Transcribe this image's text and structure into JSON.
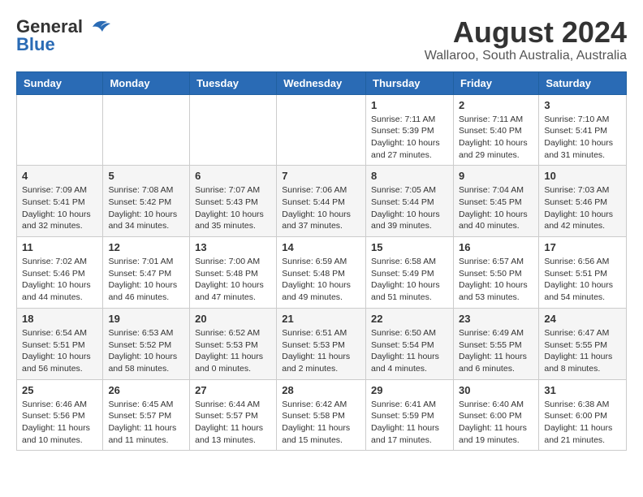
{
  "header": {
    "logo_general": "General",
    "logo_blue": "Blue",
    "month": "August 2024",
    "location": "Wallaroo, South Australia, Australia"
  },
  "weekdays": [
    "Sunday",
    "Monday",
    "Tuesday",
    "Wednesday",
    "Thursday",
    "Friday",
    "Saturday"
  ],
  "weeks": [
    [
      {
        "day": "",
        "info": ""
      },
      {
        "day": "",
        "info": ""
      },
      {
        "day": "",
        "info": ""
      },
      {
        "day": "",
        "info": ""
      },
      {
        "day": "1",
        "info": "Sunrise: 7:11 AM\nSunset: 5:39 PM\nDaylight: 10 hours\nand 27 minutes."
      },
      {
        "day": "2",
        "info": "Sunrise: 7:11 AM\nSunset: 5:40 PM\nDaylight: 10 hours\nand 29 minutes."
      },
      {
        "day": "3",
        "info": "Sunrise: 7:10 AM\nSunset: 5:41 PM\nDaylight: 10 hours\nand 31 minutes."
      }
    ],
    [
      {
        "day": "4",
        "info": "Sunrise: 7:09 AM\nSunset: 5:41 PM\nDaylight: 10 hours\nand 32 minutes."
      },
      {
        "day": "5",
        "info": "Sunrise: 7:08 AM\nSunset: 5:42 PM\nDaylight: 10 hours\nand 34 minutes."
      },
      {
        "day": "6",
        "info": "Sunrise: 7:07 AM\nSunset: 5:43 PM\nDaylight: 10 hours\nand 35 minutes."
      },
      {
        "day": "7",
        "info": "Sunrise: 7:06 AM\nSunset: 5:44 PM\nDaylight: 10 hours\nand 37 minutes."
      },
      {
        "day": "8",
        "info": "Sunrise: 7:05 AM\nSunset: 5:44 PM\nDaylight: 10 hours\nand 39 minutes."
      },
      {
        "day": "9",
        "info": "Sunrise: 7:04 AM\nSunset: 5:45 PM\nDaylight: 10 hours\nand 40 minutes."
      },
      {
        "day": "10",
        "info": "Sunrise: 7:03 AM\nSunset: 5:46 PM\nDaylight: 10 hours\nand 42 minutes."
      }
    ],
    [
      {
        "day": "11",
        "info": "Sunrise: 7:02 AM\nSunset: 5:46 PM\nDaylight: 10 hours\nand 44 minutes."
      },
      {
        "day": "12",
        "info": "Sunrise: 7:01 AM\nSunset: 5:47 PM\nDaylight: 10 hours\nand 46 minutes."
      },
      {
        "day": "13",
        "info": "Sunrise: 7:00 AM\nSunset: 5:48 PM\nDaylight: 10 hours\nand 47 minutes."
      },
      {
        "day": "14",
        "info": "Sunrise: 6:59 AM\nSunset: 5:48 PM\nDaylight: 10 hours\nand 49 minutes."
      },
      {
        "day": "15",
        "info": "Sunrise: 6:58 AM\nSunset: 5:49 PM\nDaylight: 10 hours\nand 51 minutes."
      },
      {
        "day": "16",
        "info": "Sunrise: 6:57 AM\nSunset: 5:50 PM\nDaylight: 10 hours\nand 53 minutes."
      },
      {
        "day": "17",
        "info": "Sunrise: 6:56 AM\nSunset: 5:51 PM\nDaylight: 10 hours\nand 54 minutes."
      }
    ],
    [
      {
        "day": "18",
        "info": "Sunrise: 6:54 AM\nSunset: 5:51 PM\nDaylight: 10 hours\nand 56 minutes."
      },
      {
        "day": "19",
        "info": "Sunrise: 6:53 AM\nSunset: 5:52 PM\nDaylight: 10 hours\nand 58 minutes."
      },
      {
        "day": "20",
        "info": "Sunrise: 6:52 AM\nSunset: 5:53 PM\nDaylight: 11 hours\nand 0 minutes."
      },
      {
        "day": "21",
        "info": "Sunrise: 6:51 AM\nSunset: 5:53 PM\nDaylight: 11 hours\nand 2 minutes."
      },
      {
        "day": "22",
        "info": "Sunrise: 6:50 AM\nSunset: 5:54 PM\nDaylight: 11 hours\nand 4 minutes."
      },
      {
        "day": "23",
        "info": "Sunrise: 6:49 AM\nSunset: 5:55 PM\nDaylight: 11 hours\nand 6 minutes."
      },
      {
        "day": "24",
        "info": "Sunrise: 6:47 AM\nSunset: 5:55 PM\nDaylight: 11 hours\nand 8 minutes."
      }
    ],
    [
      {
        "day": "25",
        "info": "Sunrise: 6:46 AM\nSunset: 5:56 PM\nDaylight: 11 hours\nand 10 minutes."
      },
      {
        "day": "26",
        "info": "Sunrise: 6:45 AM\nSunset: 5:57 PM\nDaylight: 11 hours\nand 11 minutes."
      },
      {
        "day": "27",
        "info": "Sunrise: 6:44 AM\nSunset: 5:57 PM\nDaylight: 11 hours\nand 13 minutes."
      },
      {
        "day": "28",
        "info": "Sunrise: 6:42 AM\nSunset: 5:58 PM\nDaylight: 11 hours\nand 15 minutes."
      },
      {
        "day": "29",
        "info": "Sunrise: 6:41 AM\nSunset: 5:59 PM\nDaylight: 11 hours\nand 17 minutes."
      },
      {
        "day": "30",
        "info": "Sunrise: 6:40 AM\nSunset: 6:00 PM\nDaylight: 11 hours\nand 19 minutes."
      },
      {
        "day": "31",
        "info": "Sunrise: 6:38 AM\nSunset: 6:00 PM\nDaylight: 11 hours\nand 21 minutes."
      }
    ]
  ]
}
